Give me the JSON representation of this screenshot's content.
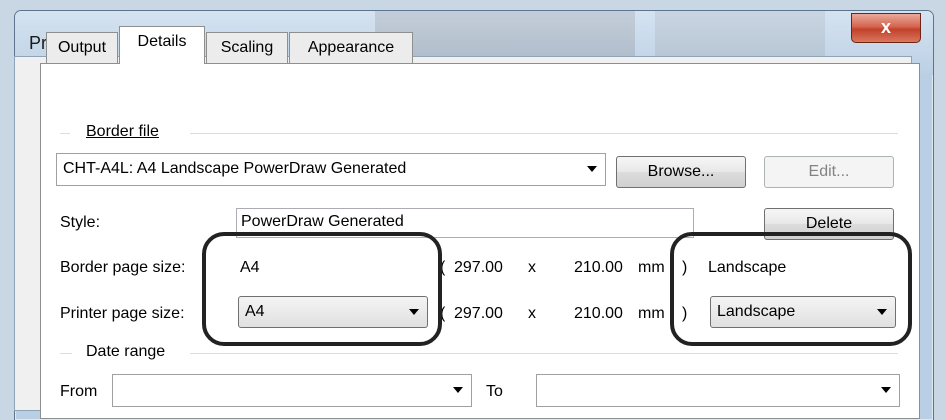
{
  "window": {
    "title": "Print",
    "close_glyph": "x"
  },
  "tabs": [
    {
      "label": "Output",
      "active": false
    },
    {
      "label": "Details",
      "active": true
    },
    {
      "label": "Scaling",
      "active": false
    },
    {
      "label": "Appearance",
      "active": false
    }
  ],
  "border_file": {
    "group_label": "Border file",
    "selected": "CHT-A4L: A4 Landscape PowerDraw Generated",
    "browse_label": "Browse...",
    "edit_label": "Edit..."
  },
  "style": {
    "label": "Style:",
    "value": "PowerDraw Generated",
    "delete_label": "Delete"
  },
  "border_page": {
    "label": "Border page size:",
    "size": "A4",
    "open_paren": "(",
    "width": "297.00",
    "times": "x",
    "height": "210.00",
    "unit": "mm",
    "close_paren": ")",
    "orientation": "Landscape"
  },
  "printer_page": {
    "label": "Printer page size:",
    "size": "A4",
    "open_paren": "(",
    "width": "297.00",
    "times": "x",
    "height": "210.00",
    "unit": "mm",
    "close_paren": ")",
    "orientation": "Landscape"
  },
  "date_range": {
    "group_label": "Date range",
    "from_label": "From",
    "from_value": "",
    "to_label": "To",
    "to_value": ""
  },
  "colors": {
    "highlight": "#222222",
    "close_button": "#c2412b"
  }
}
